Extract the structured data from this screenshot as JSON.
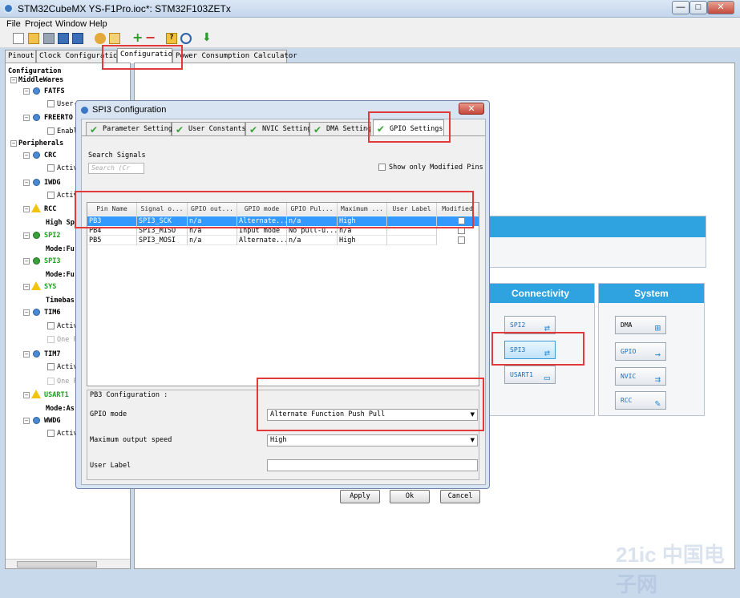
{
  "window": {
    "title": "STM32CubeMX YS-F1Pro.ioc*: STM32F103ZETx",
    "min": "—",
    "max": "□",
    "close": "✕"
  },
  "menu": [
    "File",
    "Project",
    "Window",
    "Help"
  ],
  "toolbar_icons": [
    "new-icon",
    "open-icon",
    "doc-icon",
    "save-icon",
    "save-as-icon",
    "gear-icon",
    "generate-icon",
    "plus-icon",
    "minus-icon",
    "help-icon",
    "search-icon",
    "download-icon"
  ],
  "main_tabs": [
    "Pinout",
    "Clock Configuration",
    "Configuration",
    "Power Consumption Calculator"
  ],
  "tree": {
    "root": "Configuration",
    "middlewares": "MiddleWares",
    "fatfs": "FATFS",
    "fatfs_opt": "User-",
    "freertos": "FREERTO",
    "freertos_opt": "Enabl",
    "peripherals": "Peripherals",
    "crc": "CRC",
    "crc_opt": "Activ",
    "iwdg": "IWDG",
    "iwdg_opt": "Activ",
    "rcc": "RCC",
    "rcc_opt": "High Sp",
    "spi2": "SPI2",
    "spi2_opt": "Mode:Fu",
    "spi3": "SPI3",
    "spi3_opt": "Mode:Fu",
    "sys": "SYS",
    "sys_opt": "Timebas",
    "tim6": "TIM6",
    "tim6_opt": "Activ",
    "tim6_opt2": "One P",
    "tim7": "TIM7",
    "tim7_opt": "Activ",
    "tim7_opt2": "One P",
    "usart1": "USART1",
    "usart1_opt": "Mode:As",
    "wwdg": "WWDG",
    "wwdg_opt": "Activ"
  },
  "right": {
    "connectivity": "Connectivity",
    "system": "System",
    "conn_buttons": [
      "SPI2",
      "SPI3",
      "USART1"
    ],
    "sys_buttons": [
      "DMA",
      "GPIO",
      "NVIC",
      "RCC"
    ]
  },
  "dialog": {
    "title": "SPI3 Configuration",
    "tabs": [
      "Parameter Settings",
      "User Constants",
      "NVIC Settings",
      "DMA Settings",
      "GPIO Settings"
    ],
    "search_label": "Search Signals",
    "search_placeholder": "Search (Cr",
    "show_modified": "Show only Modified Pins",
    "columns": [
      "Pin Name",
      "Signal o...",
      "GPIO out...",
      "GPIO mode",
      "GPIO Pul...",
      "Maximum ...",
      "User Label",
      "Modified"
    ],
    "rows": [
      [
        "PB3",
        "SPI3_SCK",
        "n/a",
        "Alternate...",
        "n/a",
        "High",
        ""
      ],
      [
        "PB4",
        "SPI3_MISO",
        "n/a",
        "Input mode",
        "No pull-u...",
        "n/a",
        ""
      ],
      [
        "PB5",
        "SPI3_MOSI",
        "n/a",
        "Alternate...",
        "n/a",
        "High",
        ""
      ]
    ],
    "pb3_conf": "PB3 Configuration :",
    "gpio_mode_label": "GPIO mode",
    "gpio_mode_value": "Alternate Function Push Pull",
    "speed_label": "Maximum output speed",
    "speed_value": "High",
    "user_label": "User Label",
    "apply": "Apply",
    "ok": "Ok",
    "cancel": "Cancel"
  },
  "watermark": "21ic 中国电子网"
}
